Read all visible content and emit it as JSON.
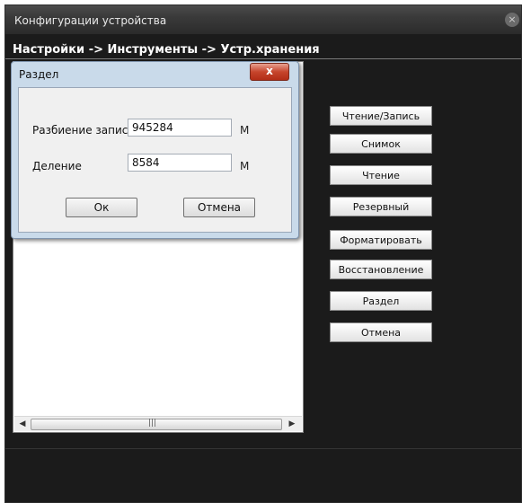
{
  "window": {
    "title": "Конфигурации устройства",
    "close_glyph": "×"
  },
  "breadcrumb": "Настройки -> Инструменты -> Устр.хранения",
  "dialog": {
    "title": "Раздел",
    "close_glyph": "x",
    "fields": [
      {
        "label": "Разбиение записи",
        "value": "945284",
        "unit": "M"
      },
      {
        "label": "Деление",
        "value": "8584",
        "unit": "M"
      }
    ],
    "ok_label": "Ок",
    "cancel_label": "Отмена"
  },
  "side_buttons": [
    "Чтение/Запись",
    "Снимок",
    "Чтение",
    "Резервный",
    "Форматировать",
    "Восстановление",
    "Раздел",
    "Отмена"
  ],
  "scrollbar": {
    "left_arrow": "◀",
    "right_arrow": "▶",
    "grip": "|||"
  }
}
